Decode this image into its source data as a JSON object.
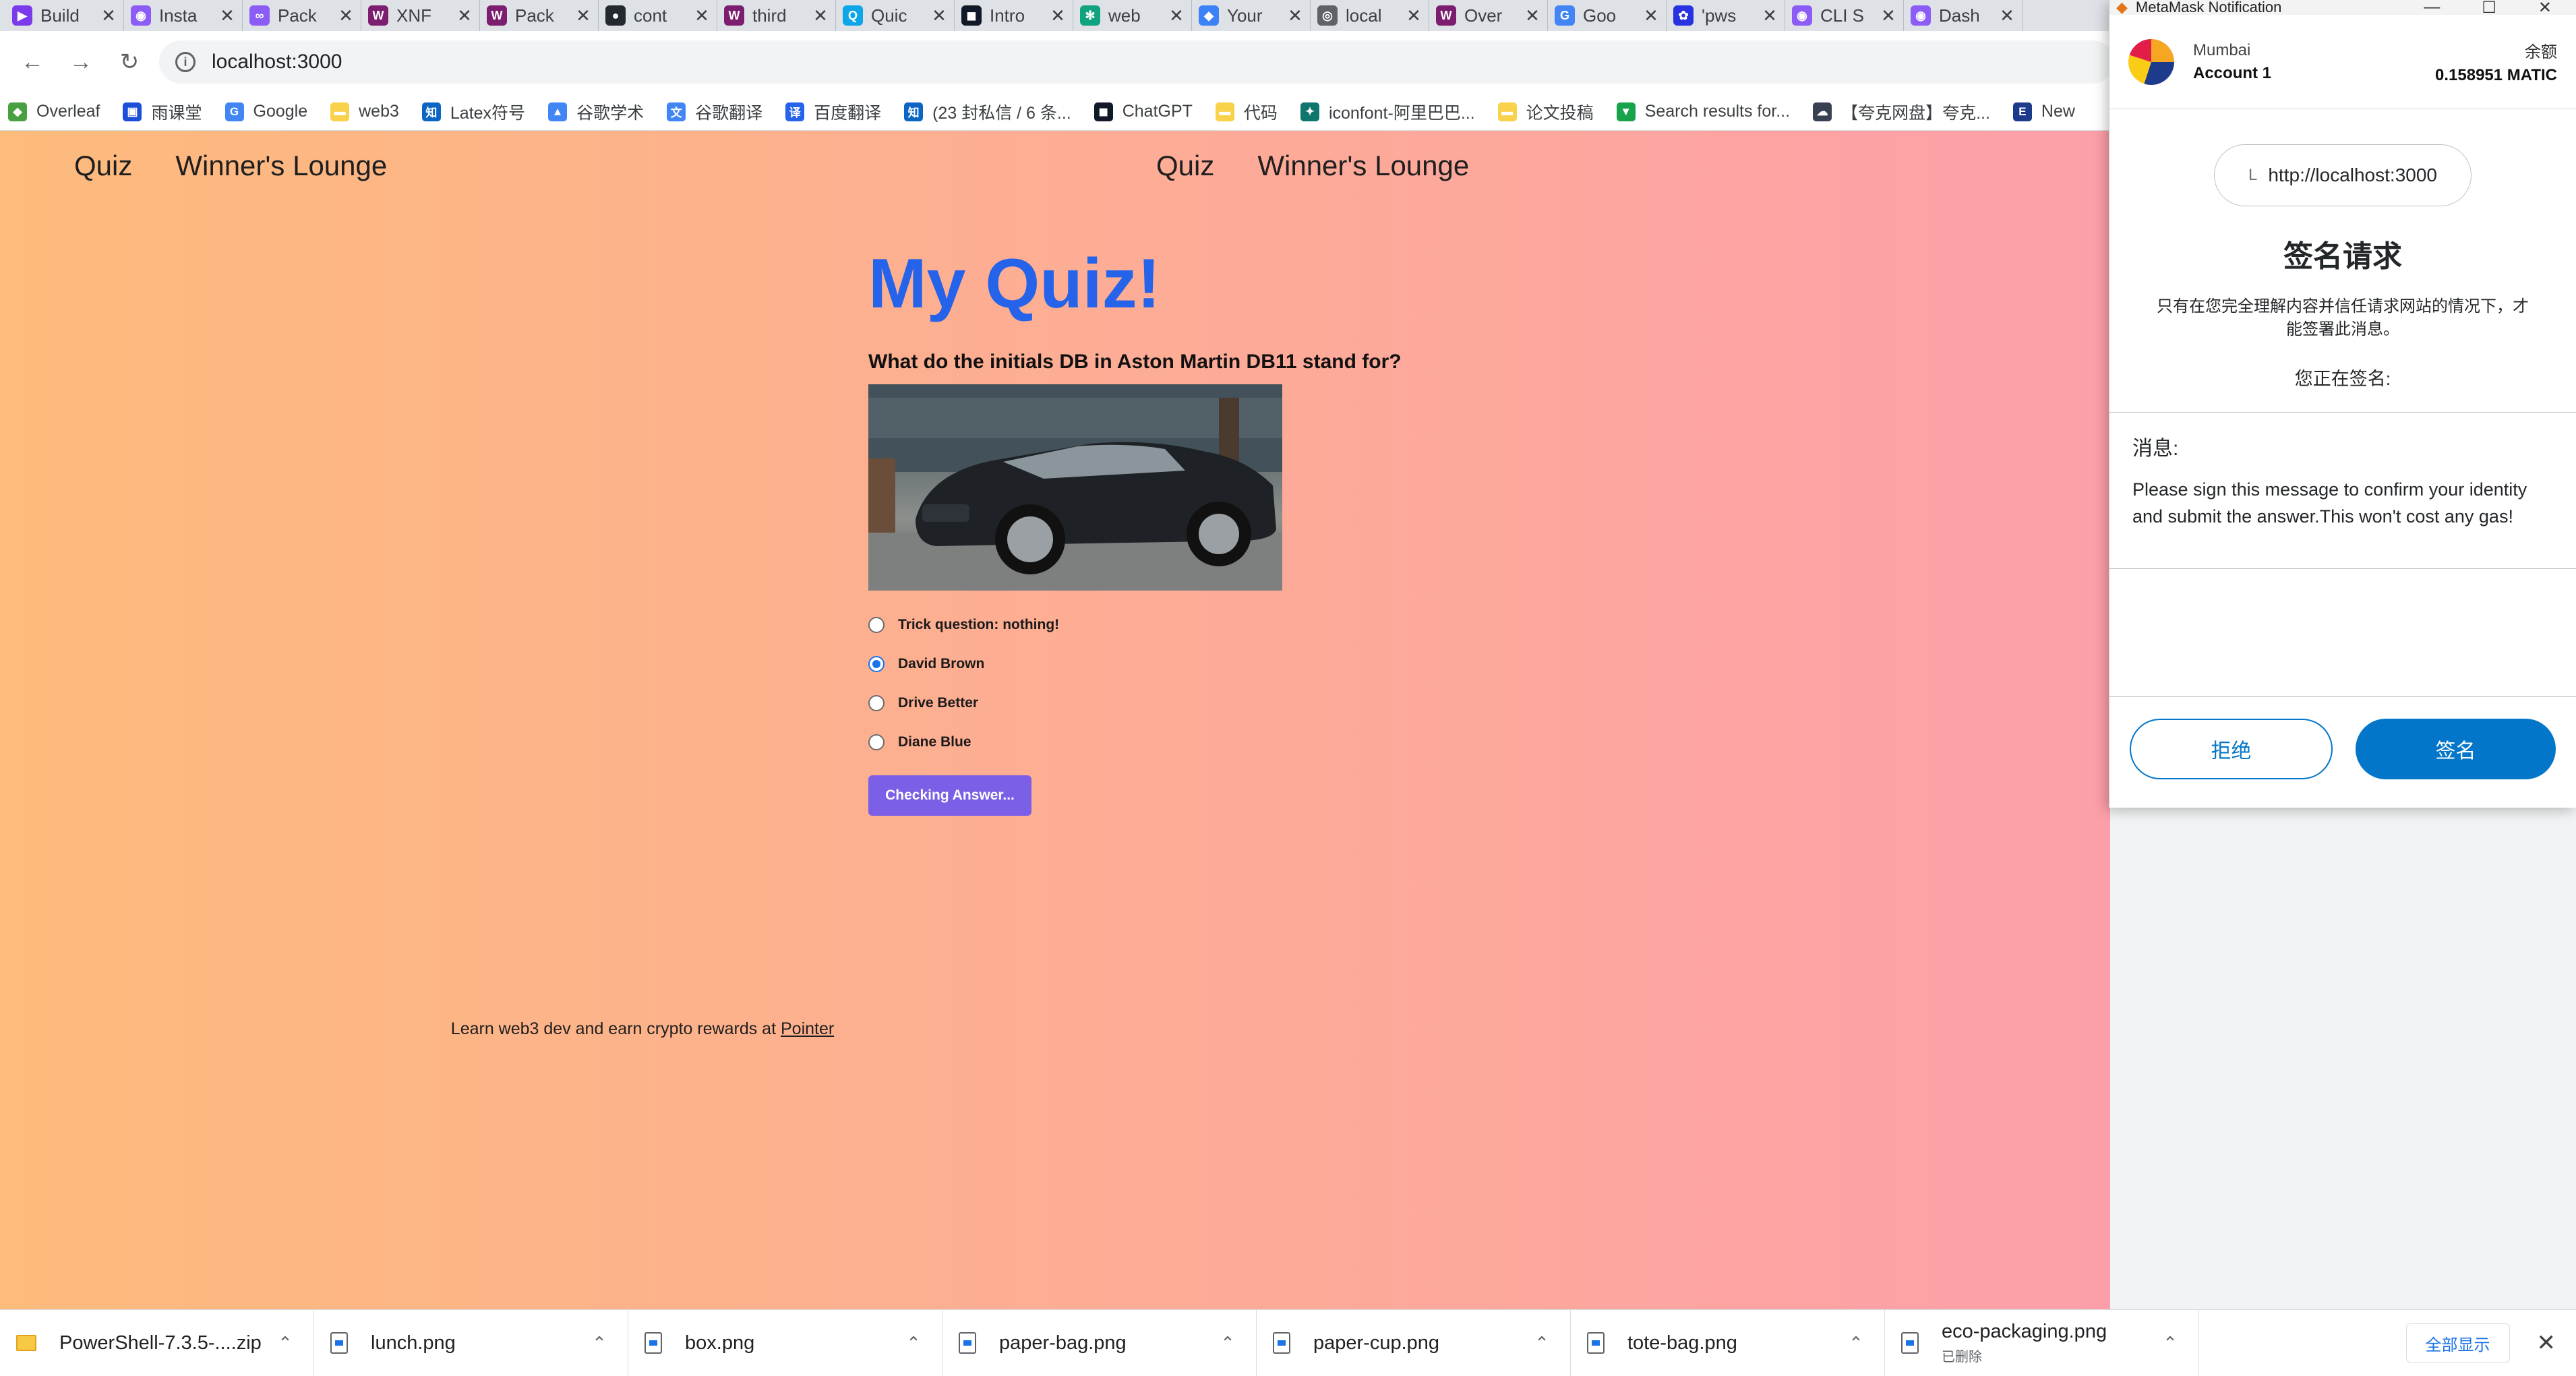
{
  "browser": {
    "tabs": [
      {
        "title": "Build",
        "color": "#7c3aed",
        "glyph": "▶"
      },
      {
        "title": "Insta",
        "color": "#8b5cf6",
        "glyph": "◉"
      },
      {
        "title": "Pack",
        "color": "#8b5cf6",
        "glyph": "∞"
      },
      {
        "title": "XNF",
        "color": "#7c1d6f",
        "glyph": "W"
      },
      {
        "title": "Pack",
        "color": "#7c1d6f",
        "glyph": "W"
      },
      {
        "title": "cont",
        "color": "#24292f",
        "glyph": "●"
      },
      {
        "title": "third",
        "color": "#7c1d6f",
        "glyph": "W"
      },
      {
        "title": "Quic",
        "color": "#0ea5e9",
        "glyph": "Q"
      },
      {
        "title": "Intro",
        "color": "#111827",
        "glyph": "◼"
      },
      {
        "title": "web",
        "color": "#10a37f",
        "glyph": "✻"
      },
      {
        "title": "Your",
        "color": "#3b82f6",
        "glyph": "◆"
      },
      {
        "title": "local",
        "color": "#5f6368",
        "glyph": "◎"
      },
      {
        "title": "Over",
        "color": "#7c1d6f",
        "glyph": "W"
      },
      {
        "title": "Goo",
        "color": "#4285f4",
        "glyph": "G"
      },
      {
        "title": "'pws",
        "color": "#2932e1",
        "glyph": "✿"
      },
      {
        "title": "CLI S",
        "color": "#8b5cf6",
        "glyph": "◉"
      },
      {
        "title": "Dash",
        "color": "#8b5cf6",
        "glyph": "◉"
      }
    ],
    "url": "localhost:3000",
    "bookmarks": [
      {
        "label": "Overleaf",
        "color": "#47a141",
        "glyph": "◆"
      },
      {
        "label": "雨课堂",
        "color": "#1d4ed8",
        "glyph": "▣"
      },
      {
        "label": "Google",
        "color": "#4285f4",
        "glyph": "G"
      },
      {
        "label": "web3",
        "color": "#f9d14a",
        "glyph": "▬"
      },
      {
        "label": "Latex符号",
        "color": "#0a66c2",
        "glyph": "知"
      },
      {
        "label": "谷歌学术",
        "color": "#4285f4",
        "glyph": "▲"
      },
      {
        "label": "谷歌翻译",
        "color": "#4285f4",
        "glyph": "文"
      },
      {
        "label": "百度翻译",
        "color": "#2563eb",
        "glyph": "译"
      },
      {
        "label": "(23 封私信 / 6 条...",
        "color": "#0a66c2",
        "glyph": "知"
      },
      {
        "label": "ChatGPT",
        "color": "#111827",
        "glyph": "◼"
      },
      {
        "label": "代码",
        "color": "#f9d14a",
        "glyph": "▬"
      },
      {
        "label": "iconfont-阿里巴巴...",
        "color": "#0f766e",
        "glyph": "✦"
      },
      {
        "label": "论文投稿",
        "color": "#f9d14a",
        "glyph": "▬"
      },
      {
        "label": "Search results for...",
        "color": "#16a34a",
        "glyph": "▼"
      },
      {
        "label": "【夸克网盘】夸克...",
        "color": "#374151",
        "glyph": "☁"
      },
      {
        "label": "New",
        "color": "#1e3a8a",
        "glyph": "E"
      }
    ]
  },
  "page": {
    "nav_left": [
      "Quiz",
      "Winner's Lounge"
    ],
    "nav_center": [
      "Quiz",
      "Winner's Lounge"
    ],
    "title": "My Quiz!",
    "question": "What do the initials DB in Aston Martin DB11 stand for?",
    "image_alt": "Aston Martin car",
    "options": [
      {
        "label": "Trick question: nothing!",
        "selected": false
      },
      {
        "label": "David Brown",
        "selected": true
      },
      {
        "label": "Drive Better",
        "selected": false
      },
      {
        "label": "Diane Blue",
        "selected": false
      }
    ],
    "button_label": "Checking Answer...",
    "footer_text": "Learn web3 dev and earn crypto rewards at ",
    "footer_link": "Pointer"
  },
  "metamask": {
    "window_title": "MetaMask Notification",
    "network": "Mumbai",
    "account": "Account 1",
    "balance_label": "余额",
    "balance": "0.158951 MATIC",
    "origin": "http://localhost:3000",
    "title": "签名请求",
    "warning": "只有在您完全理解内容并信任请求网站的情况下，才能签署此消息。",
    "signing_label": "您正在签名:",
    "message_label": "消息:",
    "message": "Please sign this message to confirm your identity and submit the answer.This won't cost any gas!",
    "reject_label": "拒绝",
    "sign_label": "签名"
  },
  "downloads": {
    "items": [
      {
        "name": "PowerShell-7.3.5-....zip",
        "type": "zip",
        "sub": ""
      },
      {
        "name": "lunch.png",
        "type": "png",
        "sub": ""
      },
      {
        "name": "box.png",
        "type": "png",
        "sub": ""
      },
      {
        "name": "paper-bag.png",
        "type": "png",
        "sub": ""
      },
      {
        "name": "paper-cup.png",
        "type": "png",
        "sub": ""
      },
      {
        "name": "tote-bag.png",
        "type": "png",
        "sub": ""
      },
      {
        "name": "eco-packaging.png",
        "type": "png",
        "sub": "已删除"
      }
    ],
    "show_all_label": "全部显示"
  }
}
